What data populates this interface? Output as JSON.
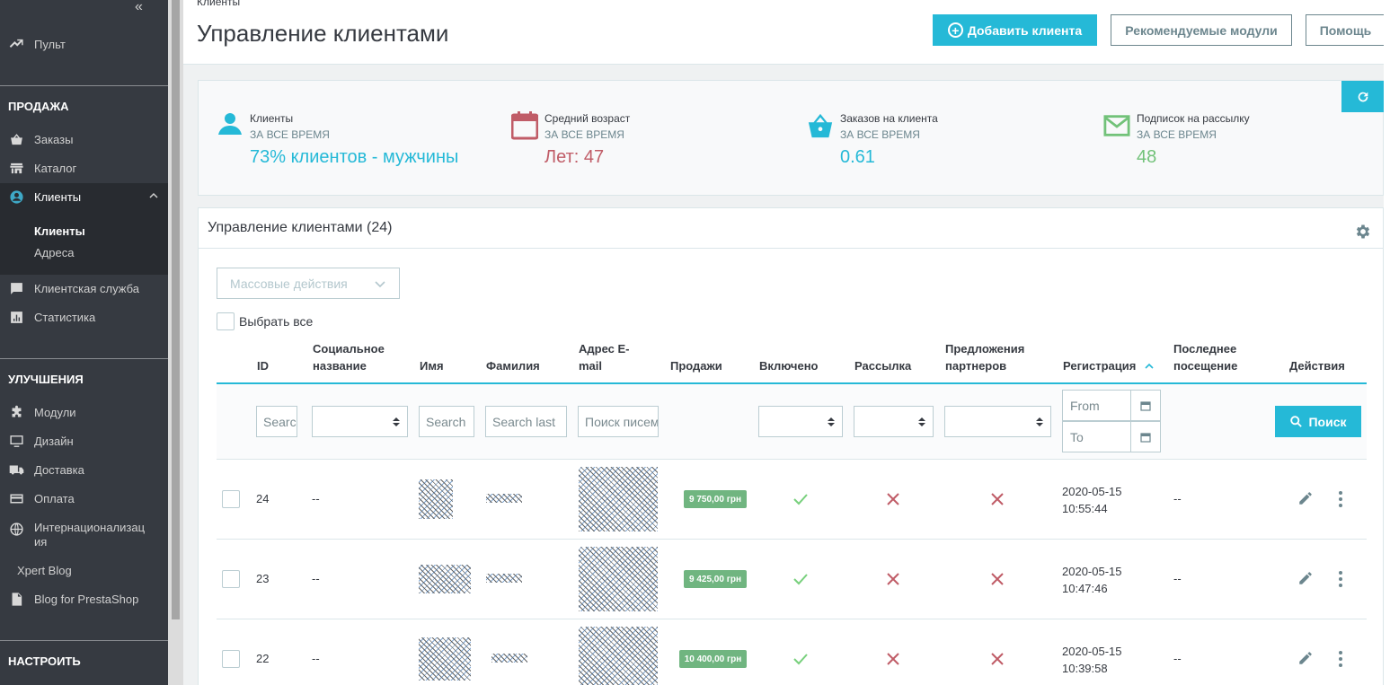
{
  "sidebar": {
    "collapse": "«",
    "dashboard": "Пульт",
    "sections": {
      "sell": "ПРОДАЖА",
      "improve": "УЛУЧШЕНИЯ",
      "configure": "НАСТРОИТЬ"
    },
    "sell_items": {
      "orders": "Заказы",
      "catalog": "Каталог",
      "customers": "Клиенты",
      "customer_service": "Клиентская служба",
      "stats": "Статистика"
    },
    "customers_sub": {
      "customers": "Клиенты",
      "addresses": "Адреса"
    },
    "improve_items": {
      "modules": "Модули",
      "design": "Дизайн",
      "shipping": "Доставка",
      "payment": "Оплата",
      "intl_line1": "Интернационализац",
      "intl_line2": "ия",
      "xpert_blog": "Xpert Blog",
      "blog_prestashop": "Blog for PrestaShop"
    }
  },
  "header": {
    "breadcrumb": "Клиенты",
    "title": "Управление клиентами",
    "add_button": "Добавить клиента",
    "modules_button": "Рекомендуемые модули",
    "help_button": "Помощь"
  },
  "kpi": {
    "customers": {
      "title": "Клиенты",
      "subtitle": "ЗА ВСЕ ВРЕМЯ",
      "value": "73% клиентов - мужчины"
    },
    "age": {
      "title": "Средний возраст",
      "subtitle": "ЗА ВСЕ ВРЕМЯ",
      "value": "Лет: 47"
    },
    "orders": {
      "title": "Заказов на клиента",
      "subtitle": "ЗА ВСЕ ВРЕМЯ",
      "value": "0.61"
    },
    "newsletter": {
      "title": "Подписок на рассылку",
      "subtitle": "ЗА ВСЕ ВРЕМЯ",
      "value": "48"
    },
    "colors": {
      "customers": "#25b9d7",
      "age": "#c05c67",
      "orders": "#25b9d7",
      "newsletter": "#72c279"
    }
  },
  "grid": {
    "title": "Управление клиентами (24)",
    "bulk_actions": "Массовые действия",
    "select_all": "Выбрать все",
    "columns": {
      "id": "ID",
      "social_title_1": "Социальное",
      "social_title_2": "название",
      "first_name": "Имя",
      "last_name": "Фамилия",
      "email_1": "Адрес E-",
      "email_2": "mail",
      "sales": "Продажи",
      "enabled": "Включено",
      "newsletter": "Рассылка",
      "partner_1": "Предложения",
      "partner_2": "партнеров",
      "registration": "Регистрация",
      "last_visit_1": "Последнее",
      "last_visit_2": "посещение",
      "actions": "Действия"
    },
    "filters": {
      "id_placeholder": "Search",
      "first_name_placeholder": "Search",
      "last_name_placeholder": "Search last",
      "email_placeholder": "Поиск писем",
      "date_from": "From",
      "date_to": "To",
      "search_button": "Поиск"
    },
    "rows": [
      {
        "id": "24",
        "social": "--",
        "sales": "9 750,00 грн",
        "date": "2020-05-15",
        "time": "10:55:44",
        "last_visit": "--"
      },
      {
        "id": "23",
        "social": "--",
        "sales": "9 425,00 грн",
        "date": "2020-05-15",
        "time": "10:47:46",
        "last_visit": "--"
      },
      {
        "id": "22",
        "social": "--",
        "sales": "10 400,00 грн",
        "date": "2020-05-15",
        "time": "10:39:58",
        "last_visit": "--"
      }
    ]
  }
}
